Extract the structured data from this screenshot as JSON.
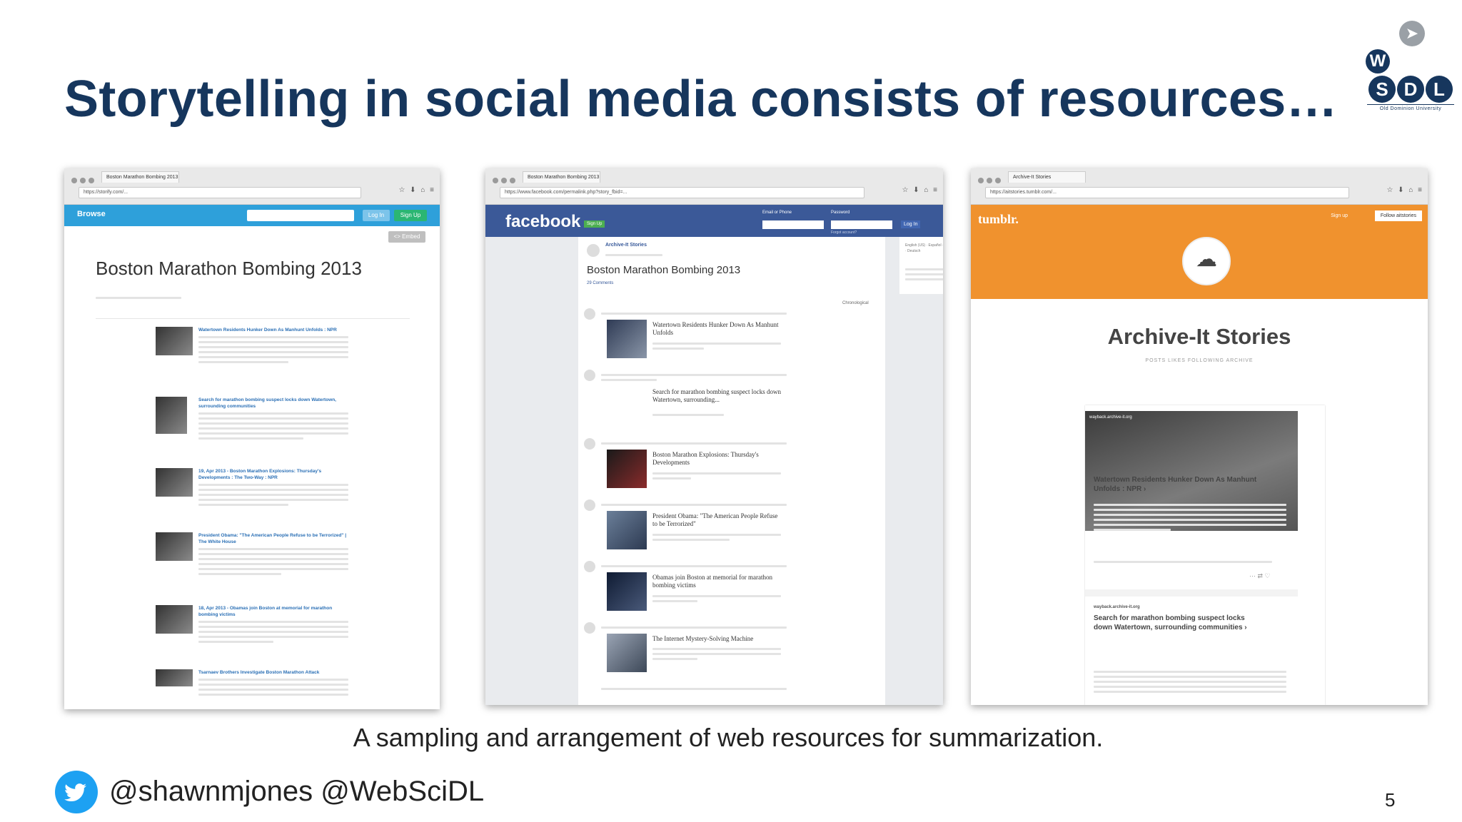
{
  "slide": {
    "title": "Storytelling in social media consists of resources…",
    "caption": "A sampling and arrangement of web resources for summarization.",
    "twitter_handles": "@shawnmjones @WebSciDL",
    "page_number": "5"
  },
  "logo": {
    "letter_w": "W",
    "letter_s": "S",
    "letter_d": "D",
    "letter_l": "L",
    "university": "Old Dominion University"
  },
  "storify": {
    "tab_label": "Boston Marathon Bombing 2013",
    "url": "https://storify.com/...",
    "nav_browse": "Browse",
    "login": "Log In",
    "signup": "Sign Up",
    "embed": "<> Embed",
    "story_title": "Boston Marathon Bombing 2013",
    "items": [
      {
        "headline": "Watertown Residents Hunker Down As Manhunt Unfolds : NPR"
      },
      {
        "headline": "Search for marathon bombing suspect locks down Watertown, surrounding communities"
      },
      {
        "headline": "19, Apr 2013 - Boston Marathon Explosions: Thursday's Developments : The Two-Way : NPR"
      },
      {
        "headline": "President Obama: \"The American People Refuse to be Terrorized\" | The White House"
      },
      {
        "headline": "18, Apr 2013 - Obamas join Boston at memorial for marathon bombing victims"
      },
      {
        "headline": "Tsarnaev Brothers Investigate Boston Marathon Attack"
      }
    ]
  },
  "facebook": {
    "tab_label": "Boston Marathon Bombing 2013",
    "url": "https://www.facebook.com/permalink.php?story_fbid=...",
    "logo": "facebook",
    "signup": "Sign Up",
    "email_label": "Email or Phone",
    "password_label": "Password",
    "login": "Log In",
    "forgot": "Forgot account?",
    "page_name": "Archive-It Stories",
    "post_title": "Boston Marathon Bombing 2013",
    "comments": "29 Comments",
    "sort": "Chronological",
    "languages": "English (US) · Español · Português (Brasil) · Français (France) · Deutsch",
    "entries": [
      {
        "title": "Watertown Residents Hunker Down As Manhunt Unfolds"
      },
      {
        "title": "Search for marathon bombing suspect locks down Watertown, surrounding..."
      },
      {
        "title": "Boston Marathon Explosions: Thursday's Developments"
      },
      {
        "title": "President Obama: \"The American People Refuse to be Terrorized\""
      },
      {
        "title": "Obamas join Boston at memorial for marathon bombing victims"
      },
      {
        "title": "The Internet Mystery-Solving Machine"
      }
    ]
  },
  "tumblr": {
    "tab_label": "Archive-It Stories",
    "url": "https://aitstories.tumblr.com/...",
    "logo": "tumblr.",
    "signup": "Sign up",
    "follow": "Follow aitstories",
    "blog_title": "Archive-It Stories",
    "nav": "POSTS    LIKES    FOLLOWING    ARCHIVE",
    "photo_source": "wayback.archive-it.org",
    "post1_title": "Watertown Residents Hunker Down As Manhunt Unfolds : NPR ›",
    "post2_source": "wayback.archive-it.org",
    "post2_title": "Search for marathon bombing suspect locks down Watertown, surrounding communities ›"
  },
  "colors": {
    "title": "#16365d",
    "storify_blue": "#2ea0da",
    "facebook_blue": "#3b5998",
    "tumblr_orange": "#f0922e",
    "twitter_blue": "#1da1f2"
  }
}
